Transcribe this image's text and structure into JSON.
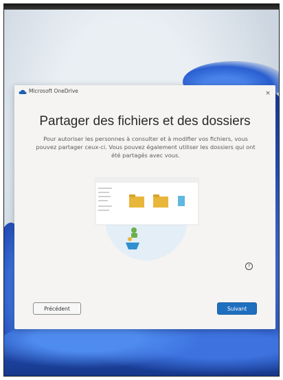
{
  "window": {
    "app_title": "Microsoft OneDrive",
    "close_glyph": "×"
  },
  "dialog": {
    "heading": "Partager des fichiers et des dossiers",
    "description": "Pour autoriser les personnes à consulter et à modifier vos fichiers, vous pouvez partager ceux-ci. Vous pouvez également utiliser les dossiers qui ont été partagés avec vous.",
    "help_glyph": "?",
    "buttons": {
      "previous": "Précédent",
      "next": "Suivant"
    }
  },
  "icons": {
    "app": "onedrive-cloud-icon",
    "close": "close-icon",
    "help": "help-icon",
    "illustration": "sharing-illustration"
  },
  "colors": {
    "accent": "#1f6fbf",
    "dialog_bg": "#f5f4f2",
    "folder": "#e8b63a",
    "wallpaper_blue": "#2452c3"
  }
}
